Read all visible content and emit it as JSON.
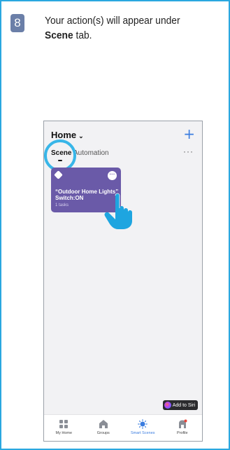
{
  "step": {
    "number": "8"
  },
  "instruction": {
    "line1": "Your action(s) will appear under",
    "bold": "Scene",
    "line2_rest": " tab."
  },
  "app": {
    "home_title": "Home",
    "tabs": [
      {
        "label": "Scene",
        "active": true
      },
      {
        "label": "Automation",
        "active": false
      }
    ],
    "scene_card": {
      "title": "“Outdoor Home Lights” Switch:ON",
      "subtitle": "1 tasks",
      "color": "#6a5aa8"
    },
    "siri_button": "Add to Siri",
    "bottom_nav": [
      {
        "label": "My Home",
        "icon": "grid-icon",
        "active": false
      },
      {
        "label": "Groups",
        "icon": "house-icon",
        "active": false
      },
      {
        "label": "Smart Scenes",
        "icon": "sun-icon",
        "active": true
      },
      {
        "label": "Profile",
        "icon": "profile-icon",
        "active": false
      }
    ]
  },
  "colors": {
    "frame_border": "#2aa8e0",
    "accent": "#3b7de0",
    "highlight": "#38b6e8",
    "step_badge": "#6b7fa8"
  }
}
